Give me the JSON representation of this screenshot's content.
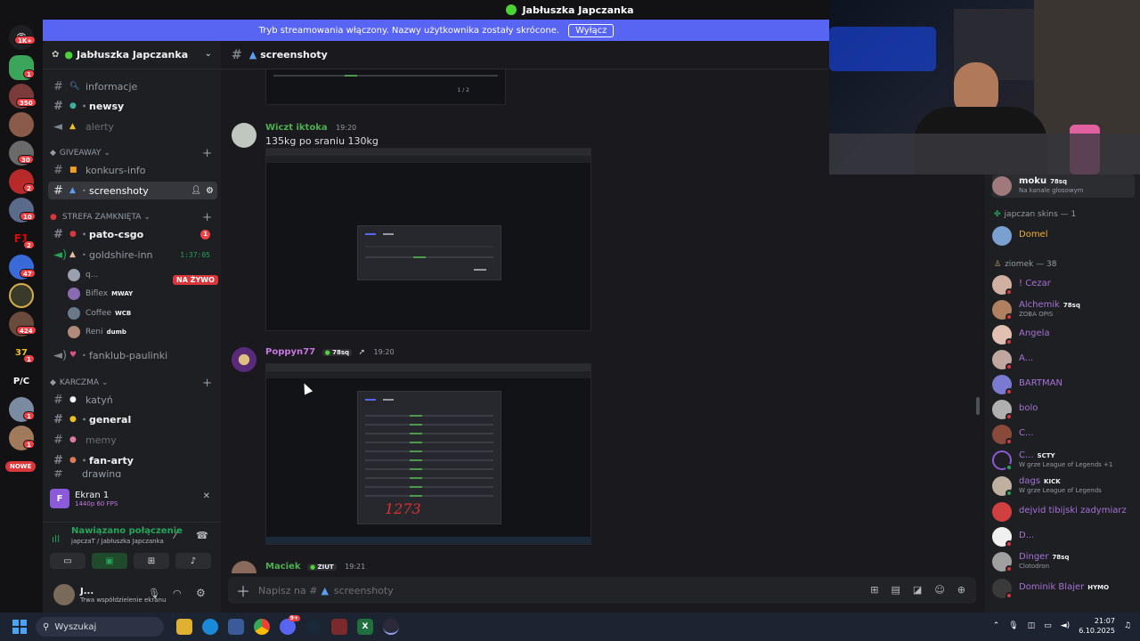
{
  "window": {
    "title": "Jabłuszka Japczanka"
  },
  "banner": {
    "text": "Tryb streamowania włączony. Nazwy użytkownika zostały skrócone.",
    "button": "Wyłącz"
  },
  "rail": {
    "badges": [
      "1K+",
      "1",
      "350",
      "30",
      "2",
      "10",
      "2",
      "47",
      "424",
      "1",
      "1",
      "1",
      "1"
    ],
    "pc_label": "P/C",
    "nowe": "NOWE"
  },
  "guild": {
    "name": "Jabłuszka Japczanka"
  },
  "channels": {
    "informacje": "informacje",
    "newsy": "newsy",
    "alerty": "alerty",
    "cat_giveaway": "GIVEAWAY",
    "konkurs": "konkurs-info",
    "screenshoty": "screenshoty",
    "cat_strefa": "STREFA ZAMKNIĘTA",
    "pato": "pato-csgo",
    "pato_badge": "1",
    "goldshire": "goldshire-inn",
    "goldshire_time": "1:37:05",
    "voice_users": [
      {
        "name": "q...",
        "tag": ""
      },
      {
        "name": "Biflex",
        "tag": "MWAY"
      },
      {
        "name": "Coffee",
        "tag": "WCB"
      },
      {
        "name": "Reni",
        "tag": "dumb"
      }
    ],
    "live": "NA ŻYWO",
    "fanklub": "fanklub-paulinki",
    "cat_karczma": "KARCZMA",
    "katyn": "katyń",
    "general": "general",
    "memy": "memy",
    "fanarty": "fan-arty",
    "drawing": "drawing"
  },
  "stream": {
    "title": "Ekran 1",
    "quality": "1440p 60 FPS"
  },
  "connection": {
    "status": "Nawiązano połączenie",
    "detail": "japczaT / Jabłuszka Japczanka"
  },
  "user": {
    "name": "J...",
    "status": "Trwa współdzielenie ekranu"
  },
  "chat": {
    "channel": "screenshoty",
    "messages": [
      {
        "author": "Wiczt iktoka",
        "time": "19:20",
        "text": "135kg po sraniu 130kg",
        "color": "#4caf50"
      },
      {
        "author": "Poppyn77",
        "tag": "78sq",
        "time": "19:20",
        "color": "#c777e0"
      },
      {
        "author": "Maciek",
        "tag": "ZIUT",
        "time": "19:21",
        "color": "#4caf50"
      }
    ],
    "composer_placeholder": "Napisz na #",
    "composer_channel": "screenshoty",
    "shot_handwritten": "1273"
  },
  "members": {
    "top": {
      "name": "moku",
      "tag": "78sq",
      "sub": "Na kanale głosowym"
    },
    "group1": "japczan skins — 1",
    "group1_members": [
      {
        "name": "Domel",
        "color": "#f0b232"
      }
    ],
    "group2": "ziomek — 38",
    "group2_members": [
      {
        "name": "! Cezar",
        "tag": "",
        "sub": ""
      },
      {
        "name": "Alchemik",
        "tag": "78sq",
        "sub": "ZOBA OPIS"
      },
      {
        "name": "Angela",
        "tag": "",
        "sub": ""
      },
      {
        "name": "A...",
        "tag": "",
        "sub": ""
      },
      {
        "name": "BARTMAN",
        "tag": "",
        "sub": ""
      },
      {
        "name": "bolo",
        "tag": "",
        "sub": ""
      },
      {
        "name": "C...",
        "tag": "",
        "sub": ""
      },
      {
        "name": "C...",
        "tag": "SCTY",
        "sub": "W grze League of Legends +1"
      },
      {
        "name": "dags",
        "tag": "KICK",
        "sub": "W grze League of Legends"
      },
      {
        "name": "dejvid tibijski zadymiarz",
        "tag": "",
        "sub": ""
      },
      {
        "name": "D...",
        "tag": "",
        "sub": ""
      },
      {
        "name": "Dinger",
        "tag": "78sq",
        "sub": "Clotodron"
      },
      {
        "name": "Dominik Blajer",
        "tag": "HYMO",
        "sub": ""
      }
    ]
  },
  "taskbar": {
    "search": "Wyszukaj",
    "time": "21:07",
    "date": "6.10.2025",
    "discord_badge": "9+"
  },
  "colors": {
    "accent": "#5865f2",
    "name_purple": "#a772d8",
    "online_green": "#23a55a"
  }
}
